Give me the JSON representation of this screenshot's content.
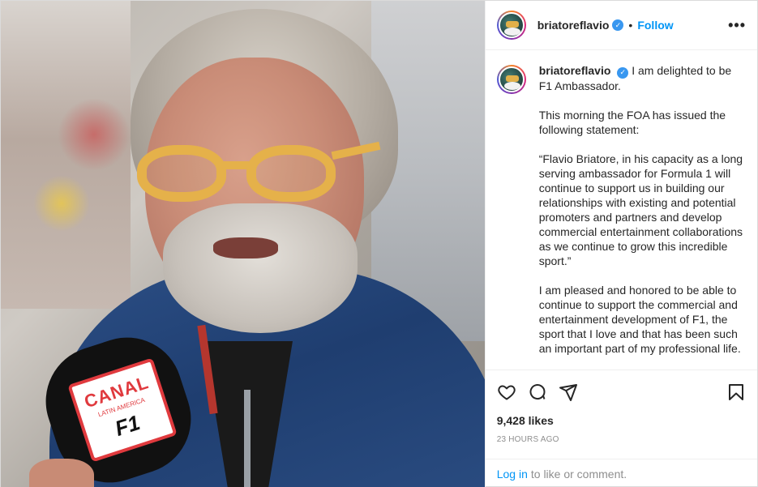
{
  "post": {
    "username": "briatoreflavio",
    "verified_icon": "verified-badge-icon",
    "follow_label": "Follow",
    "more_label": "•••",
    "caption": {
      "first_line": "I am delighted to be F1 Ambassador.",
      "paragraphs": [
        "This morning the FOA has issued the following statement:",
        "“Flavio Briatore, in his capacity as a long serving ambassador for Formula 1 will continue to support us in building our relationships with existing and potential promoters and partners and develop commercial entertainment collaborations as we continue to grow this incredible sport.”",
        "I am pleased and honored to be able to continue to support the commercial and entertainment development of F1, the sport that I love and that has been such an important part of my professional life."
      ]
    },
    "likes": "9,428 likes",
    "timestamp": "23 HOURS AGO",
    "login": {
      "link_label": "Log in",
      "rest_label": "to like or comment."
    }
  },
  "photo": {
    "mic_brand": "CANAL",
    "mic_sub": "LATIN AMERICA",
    "mic_logo": "F1"
  },
  "icons": [
    "heart-icon",
    "comment-icon",
    "share-icon",
    "bookmark-icon"
  ],
  "colors": {
    "link": "#0095f6",
    "verified": "#3897f0",
    "muted": "#8e8e8e",
    "text": "#262626"
  }
}
